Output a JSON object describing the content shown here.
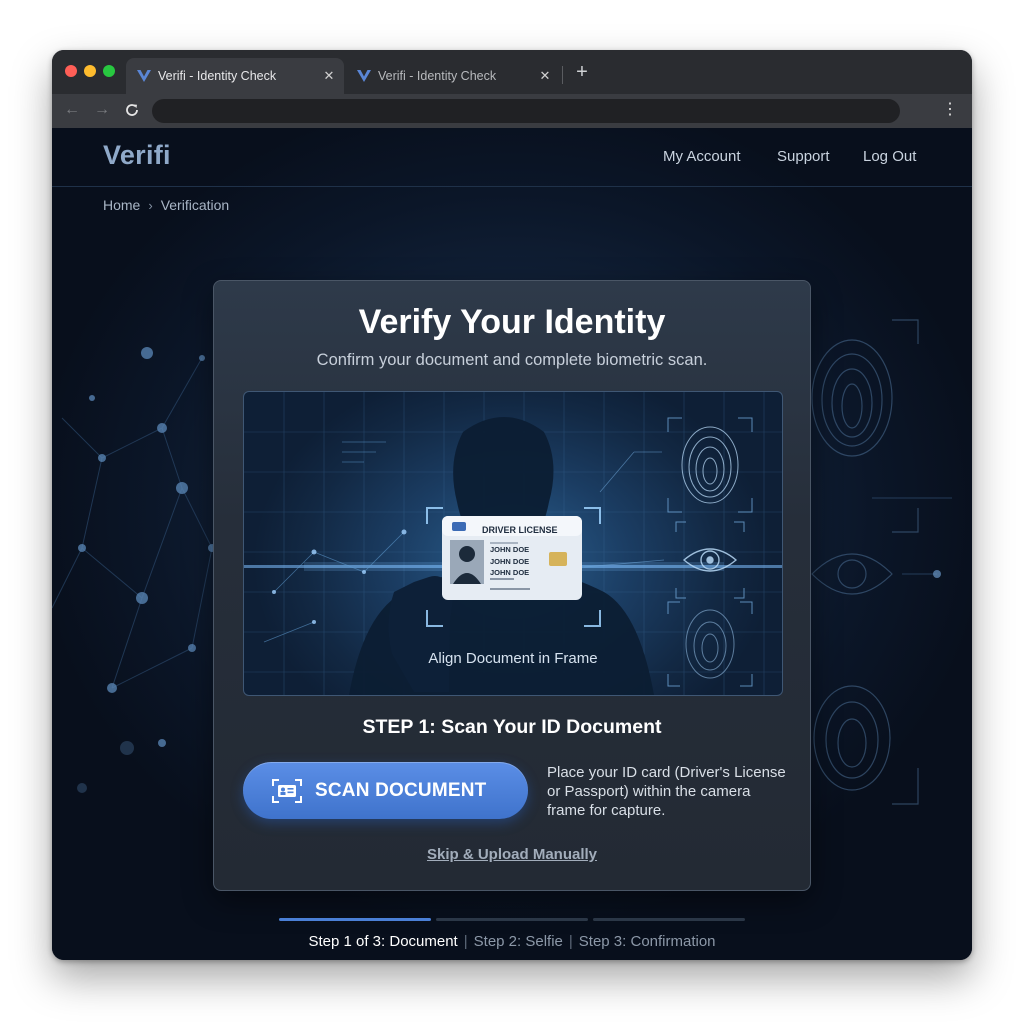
{
  "browser": {
    "tabs": [
      {
        "title": "Verifi - Identity Check",
        "active": true
      },
      {
        "title": "Verifi - Identity Check",
        "active": false
      }
    ],
    "new_tab_icon": "plus-icon",
    "url": ""
  },
  "header": {
    "logo": "Verifi",
    "nav": [
      "My Account",
      "Support",
      "Log Out"
    ]
  },
  "breadcrumb": [
    "Home",
    "Verification"
  ],
  "card": {
    "title": "Verify Your Identity",
    "subtitle": "Confirm your document and complete biometric scan.",
    "scanner": {
      "label": "Align Document in Frame",
      "id_card": {
        "heading": "DRIVER LICENSE",
        "name_1": "JOHN DOE",
        "name_2": "JOHN DOE",
        "name_3": "JOHN DOE"
      }
    },
    "step_title": "STEP 1: Scan Your ID Document",
    "scan_button": "SCAN DOCUMENT",
    "instructions": "Place your ID card (Driver's License or Passport) within the camera frame for capture.",
    "skip_link": "Skip & Upload Manually"
  },
  "progress": {
    "current": 1,
    "total": 3,
    "steps": [
      "Step 1 of 3: Document",
      "Step 2: Selfie",
      "Step 3: Confirmation"
    ]
  },
  "colors": {
    "accent": "#4a7fd6",
    "button": "#4b7fd9",
    "page_bg": "#0b1628"
  }
}
